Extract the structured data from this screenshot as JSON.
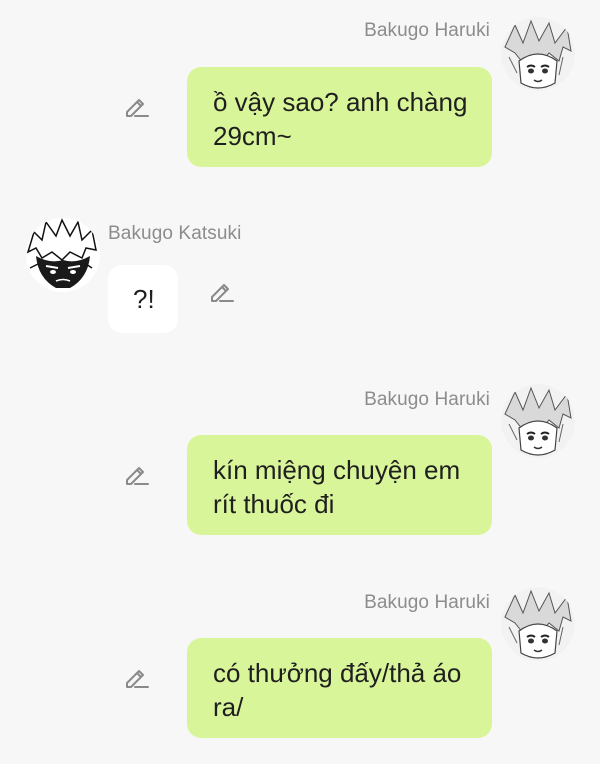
{
  "messages": [
    {
      "sender": "Bakugo Haruki",
      "direction": "outgoing",
      "text": "ồ vậy sao? anh chàng 29cm~",
      "avatar_icon": "manga-avatar-icon",
      "edit_icon": "pencil-edit-icon"
    },
    {
      "sender": "Bakugo Katsuki",
      "direction": "incoming",
      "text": "?!",
      "avatar_icon": "manga-avatar-icon",
      "edit_icon": "pencil-edit-icon"
    },
    {
      "sender": "Bakugo Haruki",
      "direction": "outgoing",
      "text": "kín miệng chuyện em rít thuốc đi",
      "avatar_icon": "manga-avatar-icon",
      "edit_icon": "pencil-edit-icon"
    },
    {
      "sender": "Bakugo Haruki",
      "direction": "outgoing",
      "text": "có thưởng đấy/thả áo ra/",
      "avatar_icon": "manga-avatar-icon",
      "edit_icon": "pencil-edit-icon"
    }
  ],
  "colors": {
    "background": "#f7f7f7",
    "outgoing_bubble": "#d9f599",
    "incoming_bubble": "#ffffff",
    "name_text": "#8c8c8c",
    "message_text": "#1f1f1f"
  }
}
